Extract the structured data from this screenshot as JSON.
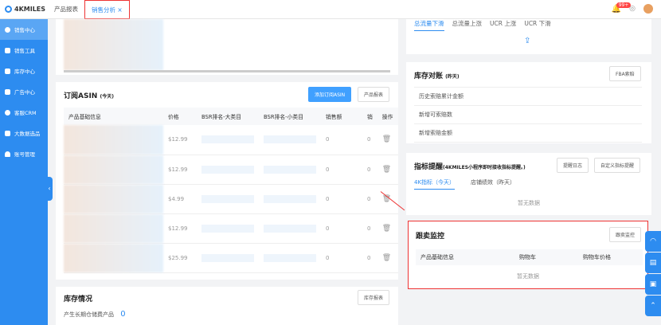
{
  "header": {
    "brand": "4KMILES",
    "tabs": [
      {
        "label": "产品报表"
      },
      {
        "label": "销售分析",
        "close": "×"
      }
    ],
    "notifications": "99+"
  },
  "sidebar": {
    "items": [
      {
        "label": "销售中心",
        "icon": "pie-chart-icon"
      },
      {
        "label": "销售工具",
        "icon": "grid-icon"
      },
      {
        "label": "库存中心",
        "icon": "home-icon"
      },
      {
        "label": "广告中心",
        "icon": "ad-icon"
      },
      {
        "label": "客服CRM",
        "icon": "headset-icon"
      },
      {
        "label": "大数据选品",
        "icon": "data-icon"
      },
      {
        "label": "账号管理",
        "icon": "user-icon"
      }
    ]
  },
  "asin": {
    "title": "订阅ASIN",
    "suffix": "(今天)",
    "add_button": "添加订阅ASIN",
    "report_button": "产品报表",
    "columns": [
      "产品基础信息",
      "价格",
      "BSR排名-大类目",
      "BSR排名-小类目",
      "销售额",
      "销",
      "操作"
    ],
    "rows": [
      {
        "price": "$12.99",
        "sales": "0",
        "s2": "0"
      },
      {
        "price": "$12.99",
        "sales": "0",
        "s2": "0"
      },
      {
        "price": "$4.99",
        "sales": "0",
        "s2": "0"
      },
      {
        "price": "$12.99",
        "sales": "0",
        "s2": "0"
      },
      {
        "price": "$25.99",
        "sales": "0",
        "s2": "0"
      }
    ]
  },
  "inventory": {
    "title": "库存情况",
    "button": "库存报表",
    "label": "产生长期仓储费产品",
    "value": "0"
  },
  "traffic": {
    "tabs": [
      "总流量下滑",
      "总流量上涨",
      "UCR 上涨",
      "UCR 下滑"
    ]
  },
  "reconcile": {
    "title": "库存对账",
    "suffix": "(昨天)",
    "button": "FBA索赔",
    "rows": [
      "历史索赔累计金额",
      "新增可索赔数",
      "新增索赔金额"
    ]
  },
  "alerts": {
    "title": "指标提醒",
    "suffix": "(4KMILES小程序即时接收指标提醒。)",
    "log_button": "提醒日志",
    "custom_button": "自定义指标提醒",
    "tabs": [
      "4K指标（今天）",
      "店铺绩效（昨天）"
    ],
    "empty": "暂无数据"
  },
  "follow": {
    "title": "跟卖监控",
    "button": "跟卖监控",
    "columns": [
      "产品基础信息",
      "购物车",
      "购物车价格"
    ],
    "empty": "暂无数据"
  }
}
